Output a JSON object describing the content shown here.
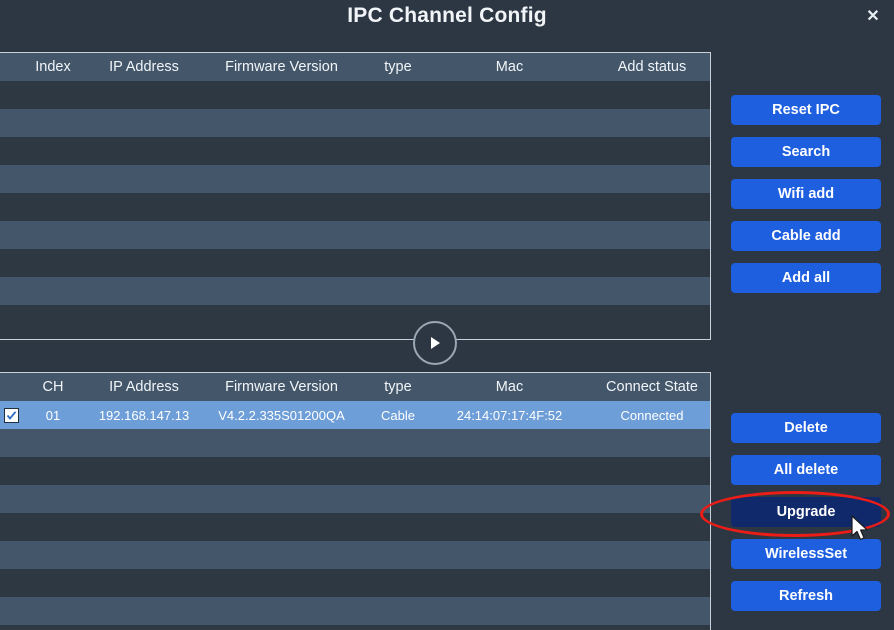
{
  "window": {
    "title": "IPC Channel Config",
    "close_label": "✕"
  },
  "colors": {
    "background": "#2d3743",
    "header_row": "#44566a",
    "row_dark": "#2e3843",
    "row_light": "#44566a",
    "row_selected": "#6e9ed8",
    "button": "#1e5fe0",
    "button_pressed": "#10296b",
    "annotation": "#ec1c17",
    "panel_border": "#c9d2da"
  },
  "discovered_table": {
    "columns": [
      "Index",
      "IP Address",
      "Firmware Version",
      "type",
      "Mac",
      "Add status"
    ],
    "rows": [],
    "empty_row_count": 9
  },
  "expand_button": {
    "icon": "play-icon"
  },
  "channel_table": {
    "columns": [
      "CH",
      "IP Address",
      "Firmware Version",
      "type",
      "Mac",
      "Connect State"
    ],
    "rows": [
      {
        "checked": true,
        "ch": "01",
        "ip_address": "192.168.147.13",
        "firmware_version": "V4.2.2.335S01200QA",
        "type": "Cable",
        "mac": "24:14:07:17:4F:52",
        "connect_state": "Connected"
      }
    ],
    "empty_row_count": 7
  },
  "top_buttons": [
    {
      "label": "Reset IPC",
      "name": "reset-ipc-button"
    },
    {
      "label": "Search",
      "name": "search-button"
    },
    {
      "label": "Wifi add",
      "name": "wifi-add-button"
    },
    {
      "label": "Cable add",
      "name": "cable-add-button"
    },
    {
      "label": "Add all",
      "name": "add-all-button"
    }
  ],
  "bottom_buttons": [
    {
      "label": "Delete",
      "name": "delete-button",
      "pressed": false
    },
    {
      "label": "All delete",
      "name": "all-delete-button",
      "pressed": false
    },
    {
      "label": "Upgrade",
      "name": "upgrade-button",
      "pressed": true
    },
    {
      "label": "WirelessSet",
      "name": "wirelessset-button",
      "pressed": false
    },
    {
      "label": "Refresh",
      "name": "refresh-button",
      "pressed": false
    }
  ]
}
